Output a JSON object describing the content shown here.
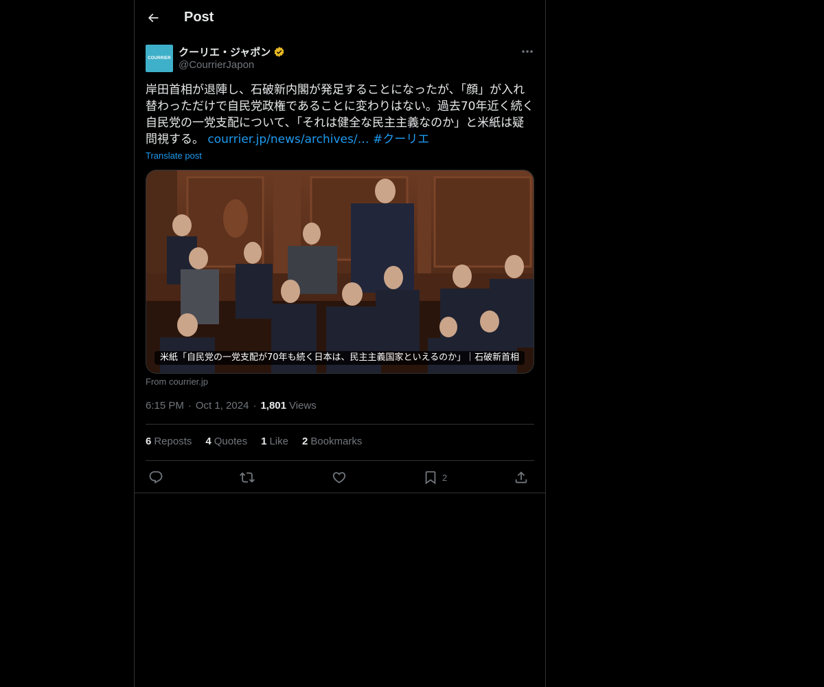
{
  "header": {
    "title": "Post"
  },
  "author": {
    "display_name": "クーリエ・ジャポン",
    "handle": "@CourrierJapon",
    "avatar_text": "COURRIER",
    "avatar_color": "#3fb0c9",
    "verified_color": "#e8b923"
  },
  "post": {
    "text": "岸田首相が退陣し、石破新内閣が発足することになったが、「顔」が入れ替わっただけで自民党政権であることに変わりはない。過去70年近く続く自民党の一党支配について、「それは健全な民主主義なのか」と米紙は疑問視する。",
    "link": "courrier.jp/news/archives/…",
    "hashtag": "#クーリエ",
    "translate": "Translate post"
  },
  "media": {
    "caption": "米紙「自民党の一党支配が70年も続く日本は、民主主義国家といえるのか」｜石破新首相",
    "source": "From courrier.jp"
  },
  "meta": {
    "time": "6:15 PM",
    "date": "Oct 1, 2024",
    "views_count": "1,801",
    "views_label": "Views"
  },
  "stats": [
    {
      "count": "6",
      "label": "Reposts"
    },
    {
      "count": "4",
      "label": "Quotes"
    },
    {
      "count": "1",
      "label": "Like"
    },
    {
      "count": "2",
      "label": "Bookmarks"
    }
  ],
  "actions": {
    "reply_icon": "reply-icon",
    "repost_icon": "repost-icon",
    "like_icon": "heart-icon",
    "bookmark_icon": "bookmark-icon",
    "bookmark_count": "2",
    "share_icon": "share-icon"
  },
  "colors": {
    "background": "#000000",
    "text": "#e7e9ea",
    "secondary": "#71767b",
    "link": "#1d9bf0",
    "border": "#2f3336"
  }
}
